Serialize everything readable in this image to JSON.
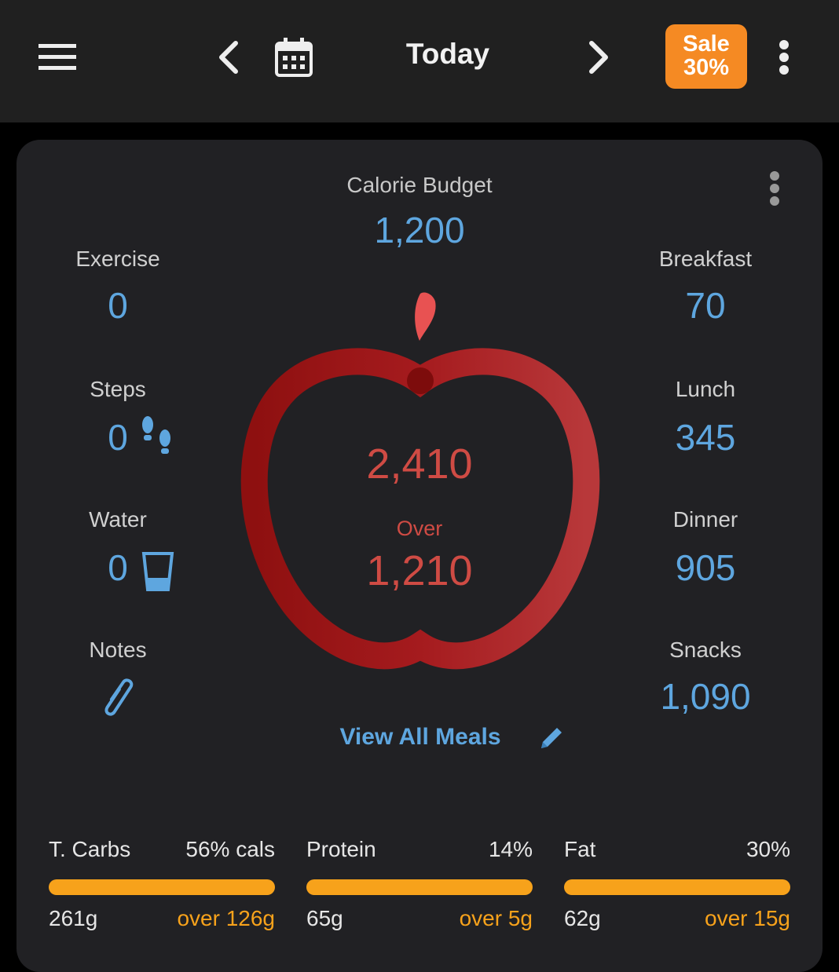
{
  "header": {
    "menu_icon": "menu-icon",
    "title": "Today",
    "sale_line1": "Sale",
    "sale_line2": "30%",
    "accent_color": "#f58a23"
  },
  "budget": {
    "label": "Calorie Budget",
    "value": "1,200"
  },
  "left_stats": [
    {
      "label": "Exercise",
      "value": "0"
    },
    {
      "label": "Steps",
      "value": "0"
    },
    {
      "label": "Water",
      "value": "0"
    },
    {
      "label": "Notes",
      "value": ""
    }
  ],
  "meals": [
    {
      "label": "Breakfast",
      "value": "70"
    },
    {
      "label": "Lunch",
      "value": "345"
    },
    {
      "label": "Dinner",
      "value": "905"
    },
    {
      "label": "Snacks",
      "value": "1,090"
    }
  ],
  "center": {
    "consumed": "2,410",
    "status": "Over",
    "difference": "1,210",
    "status_color": "#cf4b44"
  },
  "view_all_label": "View All Meals",
  "macros": [
    {
      "name": "T. Carbs",
      "percent": "56% cals",
      "grams": "261g",
      "over": "over 126g"
    },
    {
      "name": "Protein",
      "percent": "14%",
      "grams": "65g",
      "over": "over 5g"
    },
    {
      "name": "Fat",
      "percent": "30%",
      "grams": "62g",
      "over": "over 15g"
    }
  ],
  "colors": {
    "value_blue": "#5ea6df",
    "macro_orange": "#f7a21b",
    "apple_red": "#b42025"
  }
}
